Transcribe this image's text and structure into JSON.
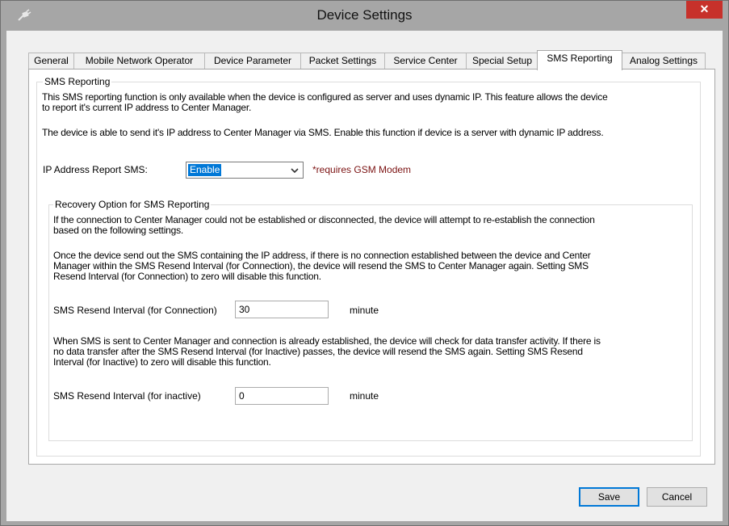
{
  "window": {
    "title": "Device Settings",
    "close_glyph": "✕",
    "app_icon": "plug-icon"
  },
  "tabs": [
    {
      "label": "General"
    },
    {
      "label": "Mobile Network Operator"
    },
    {
      "label": "Device Parameter"
    },
    {
      "label": "Packet Settings"
    },
    {
      "label": "Service Center"
    },
    {
      "label": "Special Setup"
    },
    {
      "label": "SMS Reporting",
      "active": true
    },
    {
      "label": "Analog Settings"
    }
  ],
  "sms_reporting": {
    "group_title": "SMS Reporting",
    "intro_line1": "This SMS reporting function is only available when the device is configured as server and uses dynamic IP. This feature allows the device",
    "intro_line2": "to report it's current IP address to Center Manager.",
    "send_info": "The device is able to send it's IP address to Center Manager via SMS. Enable this function if device is a server with dynamic IP address.",
    "ip_report_label": "IP Address Report SMS:",
    "ip_report_value": "Enable",
    "requirement_note": "*requires GSM Modem"
  },
  "recovery": {
    "group_title": "Recovery Option for SMS Reporting",
    "intro_line1": "If the connection to Center Manager could not be established or disconnected, the device will attempt to re-establish the connection",
    "intro_line2": "based on the following settings.",
    "conn_line1": "Once the device send out the SMS containing the IP address, if there is no connection established between the device and Center",
    "conn_line2": "Manager within the SMS Resend Interval (for Connection), the device will resend the SMS to Center Manager again. Setting SMS",
    "conn_line3": "Resend Interval (for Connection) to zero will disable this function.",
    "conn_label": "SMS Resend Interval (for Connection)",
    "conn_value": "30",
    "conn_unit": "minute",
    "inactive_line1": "When SMS is sent to Center Manager and connection is already established, the device will check for data transfer activity. If there is",
    "inactive_line2": "no data transfer after the SMS Resend Interval (for Inactive) passes, the device will resend the SMS again. Setting SMS Resend",
    "inactive_line3": "Interval (for Inactive) to zero will disable this function.",
    "inactive_label": "SMS Resend Interval (for inactive)",
    "inactive_value": "0",
    "inactive_unit": "minute"
  },
  "buttons": {
    "save": "Save",
    "cancel": "Cancel"
  }
}
